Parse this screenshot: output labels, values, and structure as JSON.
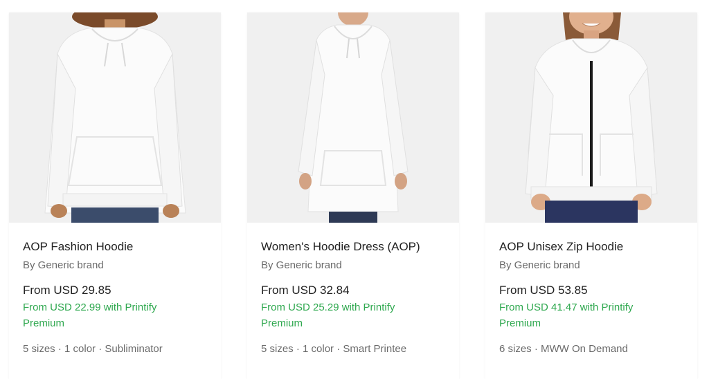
{
  "products": [
    {
      "title": "AOP Fashion Hoodie",
      "brand": "By Generic brand",
      "price": "From USD 29.85",
      "premium": "From USD 22.99 with Printify Premium",
      "meta": "5 sizes · 1 color · Subliminator"
    },
    {
      "title": "Women's Hoodie Dress (AOP)",
      "brand": "By Generic brand",
      "price": "From USD 32.84",
      "premium": "From USD 25.29 with Printify Premium",
      "meta": "5 sizes · 1 color · Smart Printee"
    },
    {
      "title": "AOP Unisex Zip Hoodie",
      "brand": "By Generic brand",
      "price": "From USD 53.85",
      "premium": "From USD 41.47 with Printify Premium",
      "meta": "6 sizes · MWW On Demand"
    }
  ],
  "colors": {
    "premium_green": "#2fa84f",
    "secondary_text": "#6b6b6b",
    "image_background": "#f1f1f1"
  }
}
